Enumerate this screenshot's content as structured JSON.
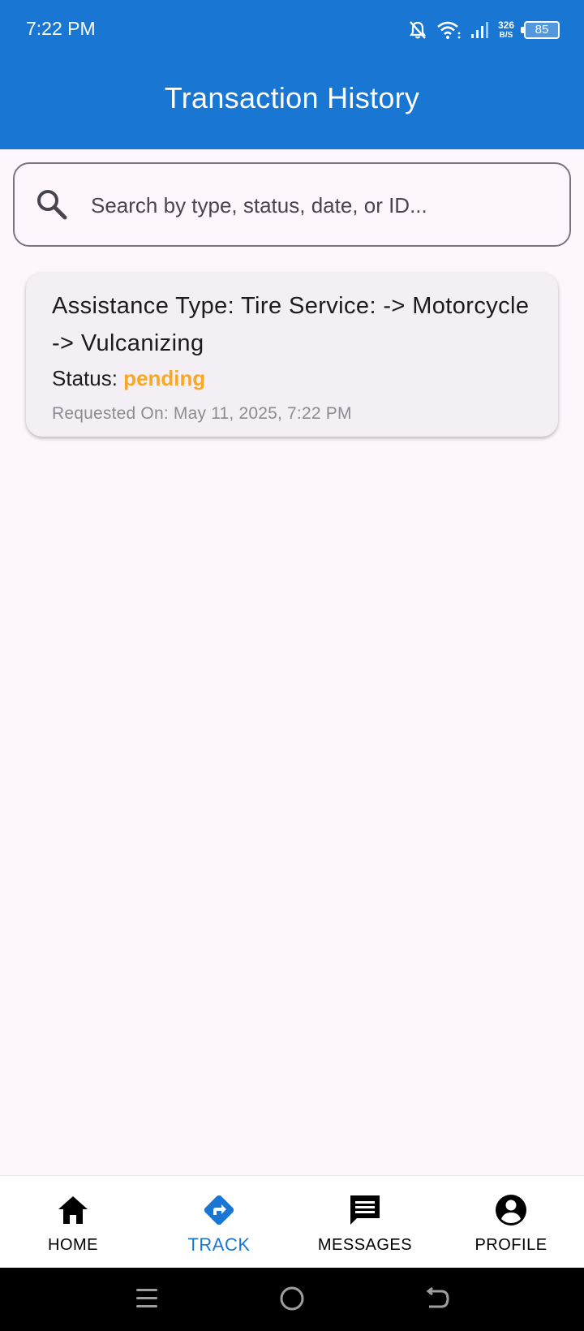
{
  "status_bar": {
    "time": "7:22 PM",
    "net_speed_value": "326",
    "net_speed_unit": "B/S",
    "battery": "85"
  },
  "app_bar": {
    "title": "Transaction History"
  },
  "search": {
    "placeholder": "Search by type, status, date, or ID..."
  },
  "transactions": [
    {
      "title": "Assistance Type: Tire Service:  -> Motorcycle -> Vulcanizing",
      "status_label": "Status: ",
      "status_value": "pending",
      "date": "Requested On: May 11, 2025, 7:22 PM"
    }
  ],
  "bottom_nav": {
    "items": [
      {
        "label": "HOME",
        "icon": "home-icon"
      },
      {
        "label": "TRACK",
        "icon": "directions-icon",
        "active": true
      },
      {
        "label": "MESSAGES",
        "icon": "message-icon"
      },
      {
        "label": "PROFILE",
        "icon": "account-circle-icon"
      }
    ]
  },
  "colors": {
    "primary": "#1976d2",
    "background": "#fdf6fd",
    "pending": "#f9a825"
  }
}
